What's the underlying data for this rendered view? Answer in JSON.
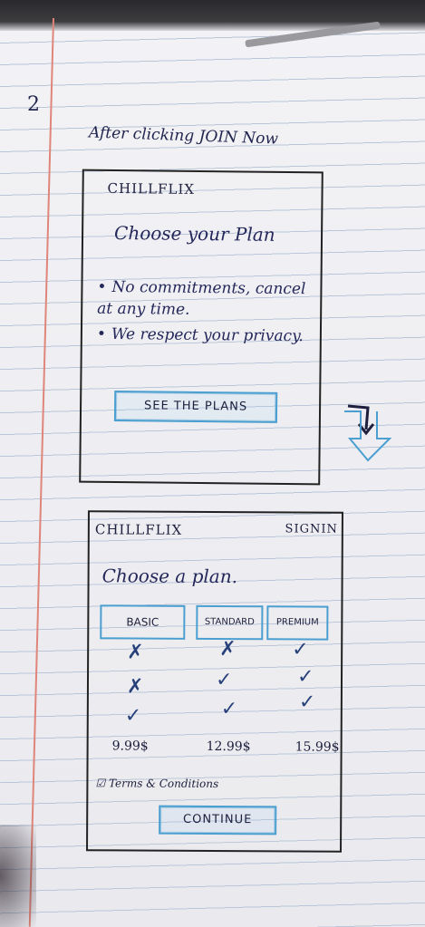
{
  "page_number": "2",
  "caption": "After clicking JOIN Now",
  "screen1": {
    "brand": "CHILLFLIX",
    "headline": "Choose your Plan",
    "bullets": [
      "No commitments, cancel at any time.",
      "We respect your privacy."
    ],
    "button": "SEE THE PLANS"
  },
  "screen2": {
    "brand": "CHILLFLIX",
    "sign_in": "SIGNIN",
    "headline": "Choose a plan.",
    "plans": [
      "BASIC",
      "STANDARD",
      "PREMIUM"
    ],
    "features": [
      [
        "✗",
        "✗",
        "✓"
      ],
      [
        "✗",
        "✓",
        "✓"
      ],
      [
        "✓",
        "✓",
        "✓"
      ]
    ],
    "prices": [
      "9.99$",
      "12.99$",
      "15.99$"
    ],
    "terms_checkbox": "☑",
    "terms_label": "Terms & Conditions",
    "continue": "CONTINUE"
  },
  "colors": {
    "ink": "#1f2358",
    "highlight": "#4a9fd0",
    "margin": "#e0857a"
  }
}
